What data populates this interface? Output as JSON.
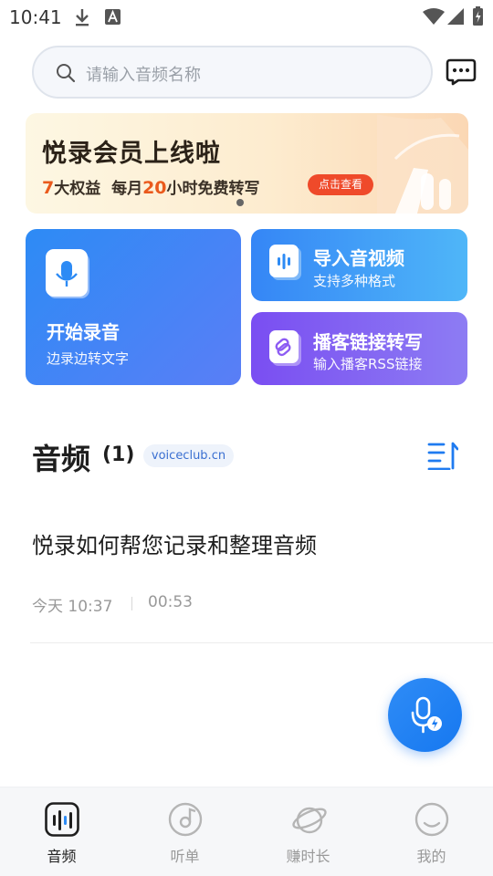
{
  "status_bar": {
    "time": "10:41"
  },
  "search": {
    "placeholder": "请输入音频名称"
  },
  "banner": {
    "title": "悦录会员上线啦",
    "sub_num1": "7",
    "sub_text1": "大权益",
    "sub_text2": "每月",
    "sub_num2": "20",
    "sub_text3": "小时免费转写",
    "button_label": "点击查看"
  },
  "cards": {
    "record": {
      "title": "开始录音",
      "subtitle": "边录边转文字"
    },
    "import": {
      "title": "导入音视频",
      "subtitle": "支持多种格式"
    },
    "podcast": {
      "title": "播客链接转写",
      "subtitle": "输入播客RSS链接"
    }
  },
  "section": {
    "title": "音频",
    "count": "(1)",
    "tag": "voiceclub.cn"
  },
  "audio_list": [
    {
      "title": "悦录如何帮您记录和整理音频",
      "date": "今天 10:37",
      "duration": "00:53"
    }
  ],
  "bottom_nav": {
    "items": [
      {
        "label": "音频",
        "icon": "audio-wave-icon",
        "active": true
      },
      {
        "label": "听单",
        "icon": "disc-icon",
        "active": false
      },
      {
        "label": "赚时长",
        "icon": "planet-icon",
        "active": false
      },
      {
        "label": "我的",
        "icon": "face-icon",
        "active": false
      }
    ]
  },
  "colors": {
    "accent": "#2d8bf5",
    "banner_highlight": "#ea5a1c",
    "banner_button": "#ef4a2a",
    "podcast_card": "#7a4ef2"
  }
}
